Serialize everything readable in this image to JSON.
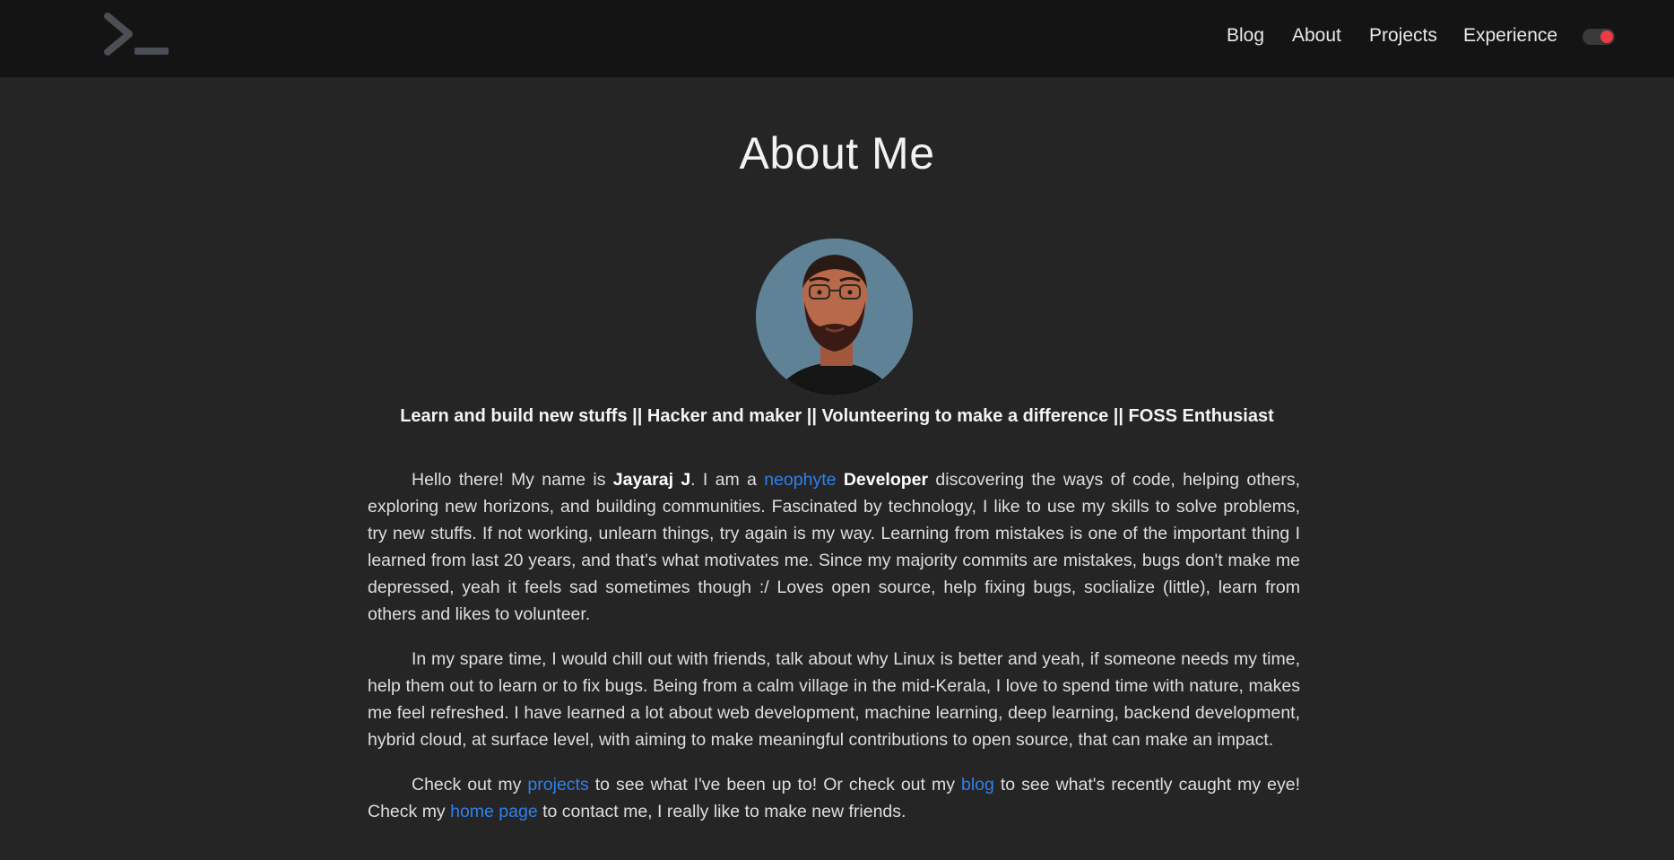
{
  "nav": {
    "logo_icon": "terminal-prompt-icon",
    "links": [
      {
        "label": "Blog"
      },
      {
        "label": "About"
      },
      {
        "label": "Projects"
      },
      {
        "label": "Experience"
      }
    ],
    "theme_toggle": {
      "state": "on",
      "accent": "#ee3b47"
    }
  },
  "page": {
    "title": "About Me",
    "avatar_icon": "avatar-portrait",
    "tagline": "Learn and build new stuffs || Hacker and maker || Volunteering to make a difference  || FOSS Enthusiast"
  },
  "paragraphs": {
    "p1": {
      "t1": "Hello there! My name is ",
      "name": "Jayaraj J",
      "t2": ". I am a ",
      "link": "neophyte",
      "t3": " ",
      "role": "Developer",
      "t4": " discovering the ways of code, helping others, exploring new horizons, and building communities. Fascinated by technology, I like to use my skills to solve problems, try new stuffs. If not working, unlearn things, try again is my way. Learning from mistakes is one of the important thing I learned from last 20 years, and that's what motivates me. Since my majority commits are mistakes, bugs don't make me depressed, yeah it feels sad sometimes though :/ Loves open source, help fixing bugs, soclialize (little), learn from others and likes to volunteer."
    },
    "p2": {
      "text": "In my spare time, I would chill out with friends, talk about why Linux is better and yeah, if someone needs my time, help them out to learn or to fix bugs. Being from a calm village in the mid-Kerala, I love to spend time with nature, makes me feel refreshed. I have learned a lot about web development, machine learning, deep learning, backend development, hybrid cloud, at surface level, with aiming to make meaningful contributions to open source, that can make an impact."
    },
    "p3": {
      "t1": "Check out my ",
      "link1": "projects",
      "t2": " to see what I've been up to! Or check out my ",
      "link2": "blog",
      "t3": " to see what's recently caught my eye! Check my ",
      "link3": "home page",
      "t4": " to contact me, I really like to make new friends."
    }
  },
  "colors": {
    "background": "#252525",
    "navbar": "#141414",
    "link": "#2f80ed",
    "toggle_accent": "#ee3b47"
  }
}
